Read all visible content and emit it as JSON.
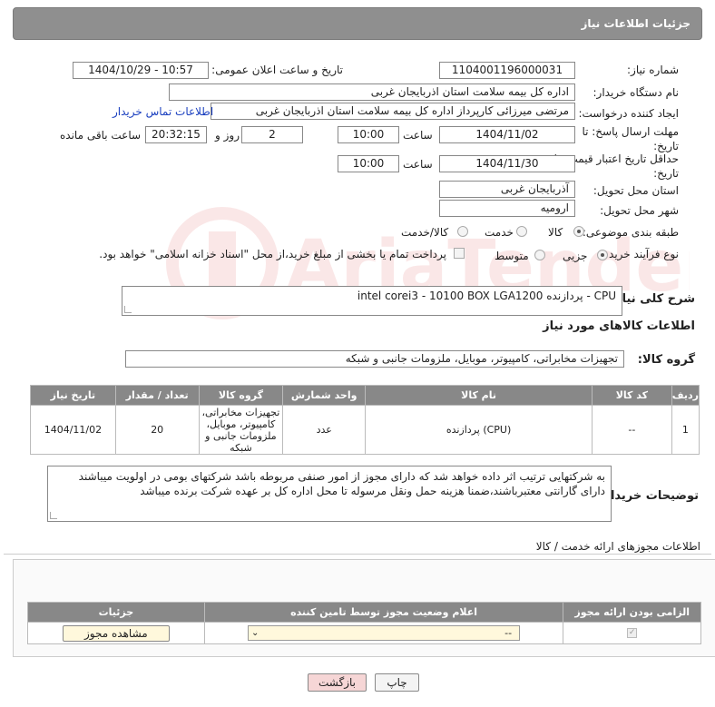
{
  "header": {
    "title": "جزئیات اطلاعات نیاز"
  },
  "form": {
    "need_number_label": "شماره نیاز:",
    "need_number": "1104001196000031",
    "announce_label": "تاریخ و ساعت اعلان عمومی:",
    "announce_value": "1404/10/29 - 10:57",
    "buyer_org_label": "نام دستگاه خریدار:",
    "buyer_org": "اداره کل بیمه سلامت استان اذربایجان غربی",
    "creator_label": "ایجاد کننده درخواست:",
    "creator": "مرتضی میرزائی کارپرداز اداره کل بیمه سلامت استان اذربایجان غربی",
    "contact_link": "اطلاعات تماس خریدار",
    "deadline_label": "مهلت ارسال پاسخ: تا تاریخ:",
    "deadline_date": "1404/11/02",
    "time_label": "ساعت",
    "deadline_time": "10:00",
    "days_value": "2",
    "days_label": "روز و",
    "remaining_time": "20:32:15",
    "remaining_label": "ساعت باقی مانده",
    "validity_label": "حداقل تاریخ اعتبار قیمت: تا تاریخ:",
    "validity_date": "1404/11/30",
    "validity_time": "10:00",
    "province_label": "استان محل تحویل:",
    "province": "آذربایجان غربی",
    "city_label": "شهر محل تحویل:",
    "city": "ارومیه",
    "category_label": "طبقه بندی موضوعی:",
    "category_options": [
      "کالا",
      "خدمت",
      "کالا/خدمت"
    ],
    "process_label": "نوع فرآیند خرید :",
    "process_options": [
      "جزیی",
      "متوسط"
    ],
    "payment_note": "پرداخت تمام یا بخشی از مبلغ خرید،از محل \"اسناد خزانه اسلامی\" خواهد بود."
  },
  "description": {
    "label": "شرح کلی نیاز:",
    "value": "CPU - پردازنده intel corei3 - 10100 BOX LGA1200"
  },
  "goods_info": {
    "title": "اطلاعات کالاهای مورد نیاز",
    "group_label": "گروه کالا:",
    "group_value": "تجهیزات مخابراتی، کامپیوتر، موبایل، ملزومات جانبی و شبکه",
    "columns": [
      "ردیف",
      "کد کالا",
      "نام کالا",
      "واحد شمارش",
      "گروه کالا",
      "تعداد / مقدار",
      "تاریخ نیاز"
    ],
    "rows": [
      {
        "row": "1",
        "code": "--",
        "name": "پردازنده (CPU)",
        "unit": "عدد",
        "group": "تجهیزات مخابراتی، کامپیوتر، موبایل، ملزومات جانبی و شبکه",
        "qty": "20",
        "date": "1404/11/02"
      }
    ]
  },
  "buyer_notes": {
    "label": "توضیحات خریدار:",
    "value": "به شرکتهایی ترتیب اثر داده خواهد شد که دارای مجوز از امور صنفی مربوطه باشد شرکتهای بومی در اولویت میباشند دارای گارانتی معتبرباشند،ضمنا هزینه حمل ونقل مرسوله تا محل اداره کل بر عهده شرکت برنده میباشد"
  },
  "permits": {
    "title": "اطلاعات مجوزهای ارائه خدمت / کالا",
    "columns": [
      "الزامی بودن ارائه مجوز",
      "اعلام وضعیت مجوز توسط تامین کننده",
      "جزئیات"
    ],
    "select_value": "--",
    "view_button": "مشاهده مجوز"
  },
  "footer": {
    "print": "چاپ",
    "back": "بازگشت"
  },
  "watermark": "AriaTender.neT",
  "colors": {
    "header": "#8f8f8f",
    "link": "#1a3fbf",
    "back_button": "#f6d6d6"
  }
}
